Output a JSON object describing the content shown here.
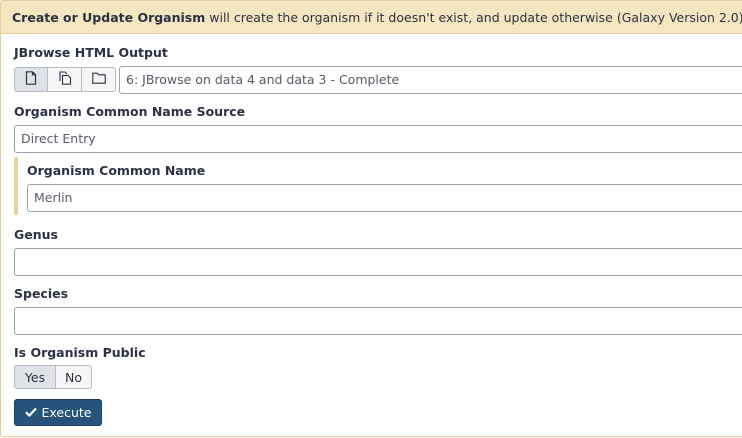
{
  "header": {
    "tool_name": "Create or Update Organism",
    "description": " will create the organism if it doesn't exist, and update otherwise (Galaxy Version 2.0)"
  },
  "jbrowse": {
    "label": "JBrowse HTML Output",
    "selected_value": "6: JBrowse on data 4 and data 3 - Complete",
    "icons": [
      "single-dataset-icon",
      "multiple-datasets-icon",
      "folder-icon"
    ]
  },
  "common_name_source": {
    "label": "Organism Common Name Source",
    "selected_value": "Direct Entry"
  },
  "common_name": {
    "label": "Organism Common Name",
    "value": "Merlin"
  },
  "genus": {
    "label": "Genus",
    "value": ""
  },
  "species": {
    "label": "Species",
    "value": ""
  },
  "is_public": {
    "label": "Is Organism Public",
    "options": [
      "Yes",
      "No"
    ],
    "selected": "Yes"
  },
  "execute": {
    "label": "Execute"
  },
  "colors": {
    "header_bg": "#f4e6c1",
    "primary_button": "#25537b",
    "accent_border": "#e8d4a1"
  }
}
